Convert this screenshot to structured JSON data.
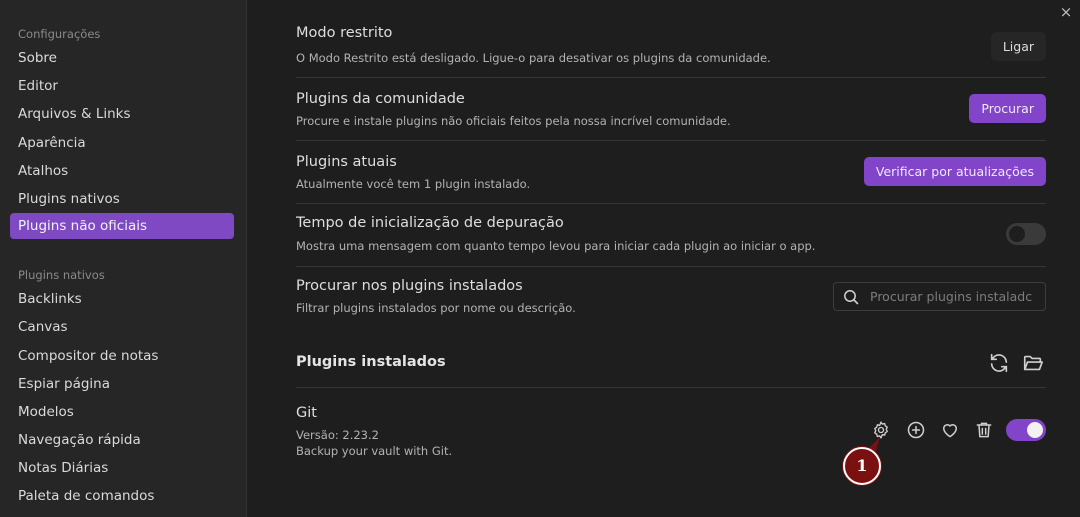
{
  "sidebar": {
    "heading_options": "Configurações",
    "options": [
      {
        "label": "Sobre"
      },
      {
        "label": "Editor"
      },
      {
        "label": "Arquivos & Links"
      },
      {
        "label": "Aparência"
      },
      {
        "label": "Atalhos"
      },
      {
        "label": "Plugins nativos"
      },
      {
        "label": "Plugins não oficiais",
        "active": true
      }
    ],
    "heading_plugins": "Plugins nativos",
    "plugins": [
      {
        "label": "Backlinks"
      },
      {
        "label": "Canvas"
      },
      {
        "label": "Compositor de notas"
      },
      {
        "label": "Espiar página"
      },
      {
        "label": "Modelos"
      },
      {
        "label": "Navegação rápida"
      },
      {
        "label": "Notas Diárias"
      },
      {
        "label": "Paleta de comandos"
      }
    ]
  },
  "close_icon": "×",
  "settings": {
    "restricted": {
      "name": "Modo restrito",
      "desc": "O Modo Restrito está desligado. Ligue-o para desativar os plugins da comunidade.",
      "button": "Ligar"
    },
    "community": {
      "name": "Plugins da comunidade",
      "desc": "Procure e instale plugins não oficiais feitos pela nossa incrível comunidade.",
      "button": "Procurar"
    },
    "current": {
      "name": "Plugins atuais",
      "desc": "Atualmente você tem 1 plugin instalado.",
      "button": "Verificar por atualizações"
    },
    "debug": {
      "name": "Tempo de inicialização de depuração",
      "desc": "Mostra uma mensagem com quanto tempo levou para iniciar cada plugin ao iniciar o app.",
      "toggle_on": false
    },
    "search": {
      "name": "Procurar nos plugins instalados",
      "desc": "Filtrar plugins instalados por nome ou descrição.",
      "placeholder": "Procurar plugins instaladc",
      "value": ""
    }
  },
  "installed": {
    "title": "Plugins instalados",
    "icons": [
      "reload-icon",
      "folder-icon"
    ]
  },
  "plugin": {
    "name": "Git",
    "version": "Versão: 2.23.2",
    "desc": "Backup your vault with Git.",
    "icons": [
      "gear-icon",
      "plus-circle-icon",
      "heart-icon",
      "trash-icon"
    ],
    "enabled": true
  },
  "annotation": {
    "label": "1"
  },
  "colors": {
    "accent": "#8244c9",
    "background": "#1e1e1e",
    "sidebar": "#262626",
    "badge": "#7a1010"
  }
}
